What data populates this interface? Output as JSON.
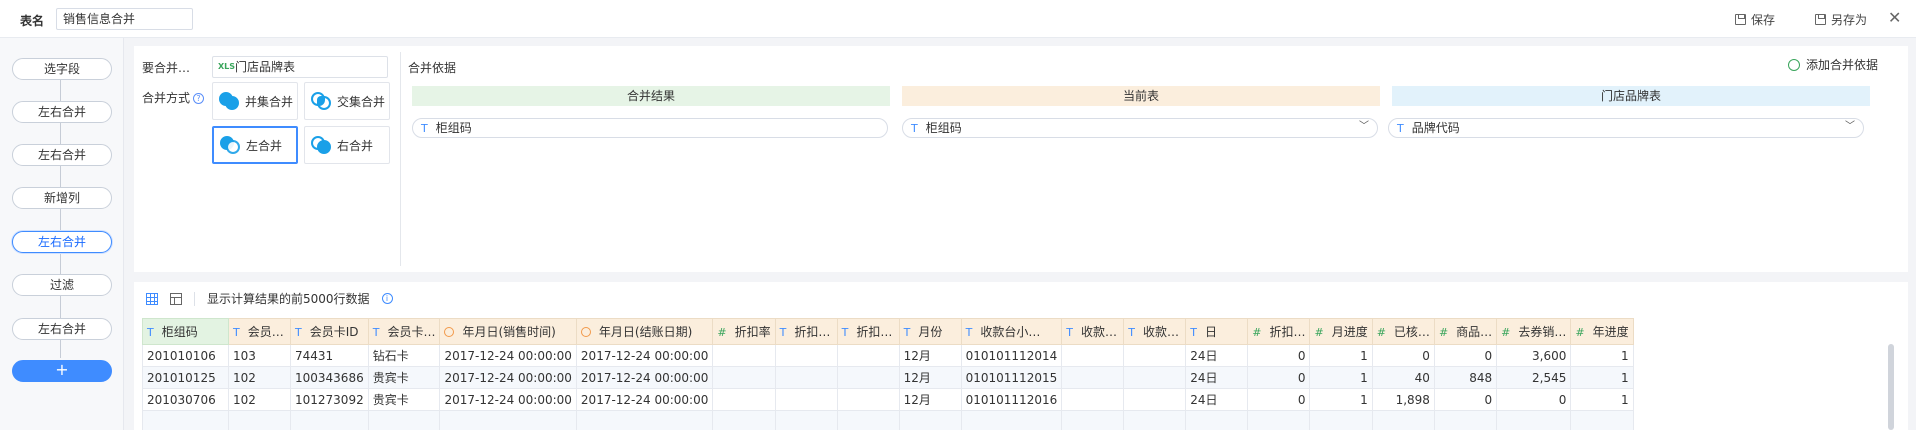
{
  "top": {
    "name_label": "表名",
    "name_value": "销售信息合并",
    "save": "保存",
    "save_as": "另存为",
    "close": "✕"
  },
  "flow": {
    "nodes": [
      "选字段",
      "左右合并",
      "左右合并",
      "新增列",
      "左右合并",
      "过滤",
      "左右合并"
    ],
    "add": "+"
  },
  "config": {
    "merge_table_label": "要合并…",
    "merge_table_value": "门店品牌表",
    "merge_table_icon": "XLS",
    "method_label": "合并方式",
    "help": "?",
    "methods": [
      "并集合并",
      "交集合并",
      "左合并",
      "右合并"
    ],
    "basis_label": "合并依据",
    "add_basis": "添加合并依据",
    "col_heads": [
      "合并结果",
      "当前表",
      "门店品牌表"
    ],
    "selects": [
      "柜组码",
      "柜组码",
      "品牌代码"
    ],
    "colors": {
      "result": "#e6f4e6",
      "current": "#fbeedd",
      "other": "#e2f2fb",
      "accent": "#3f8cff"
    }
  },
  "preview": {
    "caption": "显示计算结果的前5000行数据",
    "info": "i",
    "columns": [
      {
        "label": "柜组码",
        "type": "T"
      },
      {
        "label": "会员…",
        "type": "T"
      },
      {
        "label": "会员卡ID",
        "type": "T"
      },
      {
        "label": "会员卡…",
        "type": "T"
      },
      {
        "label": "年月日(销售时间)",
        "type": "clock"
      },
      {
        "label": "年月日(结账日期)",
        "type": "clock"
      },
      {
        "label": "折扣率",
        "type": "#"
      },
      {
        "label": "折扣…",
        "type": "T"
      },
      {
        "label": "折扣…",
        "type": "T"
      },
      {
        "label": "月份",
        "type": "T"
      },
      {
        "label": "收款台小…",
        "type": "T"
      },
      {
        "label": "收款…",
        "type": "T"
      },
      {
        "label": "收款…",
        "type": "T"
      },
      {
        "label": "日",
        "type": "T"
      },
      {
        "label": "折扣…",
        "type": "#"
      },
      {
        "label": "月进度",
        "type": "#"
      },
      {
        "label": "已核…",
        "type": "#"
      },
      {
        "label": "商品…",
        "type": "#"
      },
      {
        "label": "去券销…",
        "type": "#"
      },
      {
        "label": "年进度",
        "type": "#"
      }
    ],
    "rows": [
      [
        "201010106",
        "103",
        "74431",
        "钻石卡",
        "2017-12-24 00:00:00",
        "2017-12-24 00:00:00",
        "",
        "",
        "",
        "12月",
        "010101112014",
        "",
        "",
        "24日",
        "0",
        "1",
        "0",
        "0",
        "3,600",
        "1"
      ],
      [
        "201010125",
        "102",
        "100343686",
        "贵宾卡",
        "2017-12-24 00:00:00",
        "2017-12-24 00:00:00",
        "",
        "",
        "",
        "12月",
        "010101112015",
        "",
        "",
        "24日",
        "0",
        "1",
        "40",
        "848",
        "2,545",
        "1"
      ],
      [
        "201030706",
        "102",
        "101273092",
        "贵宾卡",
        "2017-12-24 00:00:00",
        "2017-12-24 00:00:00",
        "",
        "",
        "",
        "12月",
        "010101112016",
        "",
        "",
        "24日",
        "0",
        "1",
        "1,898",
        "0",
        "0",
        "1"
      ],
      [
        "",
        "",
        "",
        "",
        "",
        "",
        "",
        "",
        "",
        "",
        "",
        "",
        "",
        "",
        "",
        "",
        "",
        "",
        "",
        ""
      ]
    ]
  }
}
